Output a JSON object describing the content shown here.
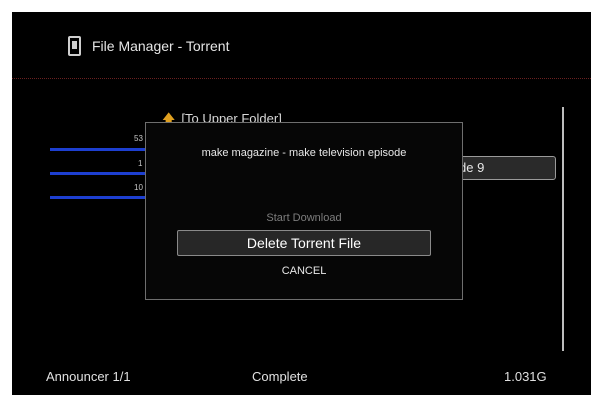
{
  "header": {
    "title": "File Manager - Torrent",
    "icon": "file-manager-icon"
  },
  "list": {
    "upper_folder_label": "[To Upper Folder]",
    "upper_folder_icon": "up-arrow-icon",
    "small_numbers": [
      "53",
      "1",
      "10"
    ],
    "highlighted_item": "de 9"
  },
  "dialog": {
    "message": "make magazine - make television episode",
    "options": {
      "start_download": "Start Download",
      "delete_torrent": "Delete Torrent File",
      "cancel": "CANCEL"
    }
  },
  "footer": {
    "announcer": "Announcer 1/1",
    "status": "Complete",
    "size": "1.031G"
  },
  "colors": {
    "background": "#000000",
    "accent_blue": "#1d3fd0",
    "divider": "#6a2020",
    "folder_arrow": "#e0a020"
  }
}
